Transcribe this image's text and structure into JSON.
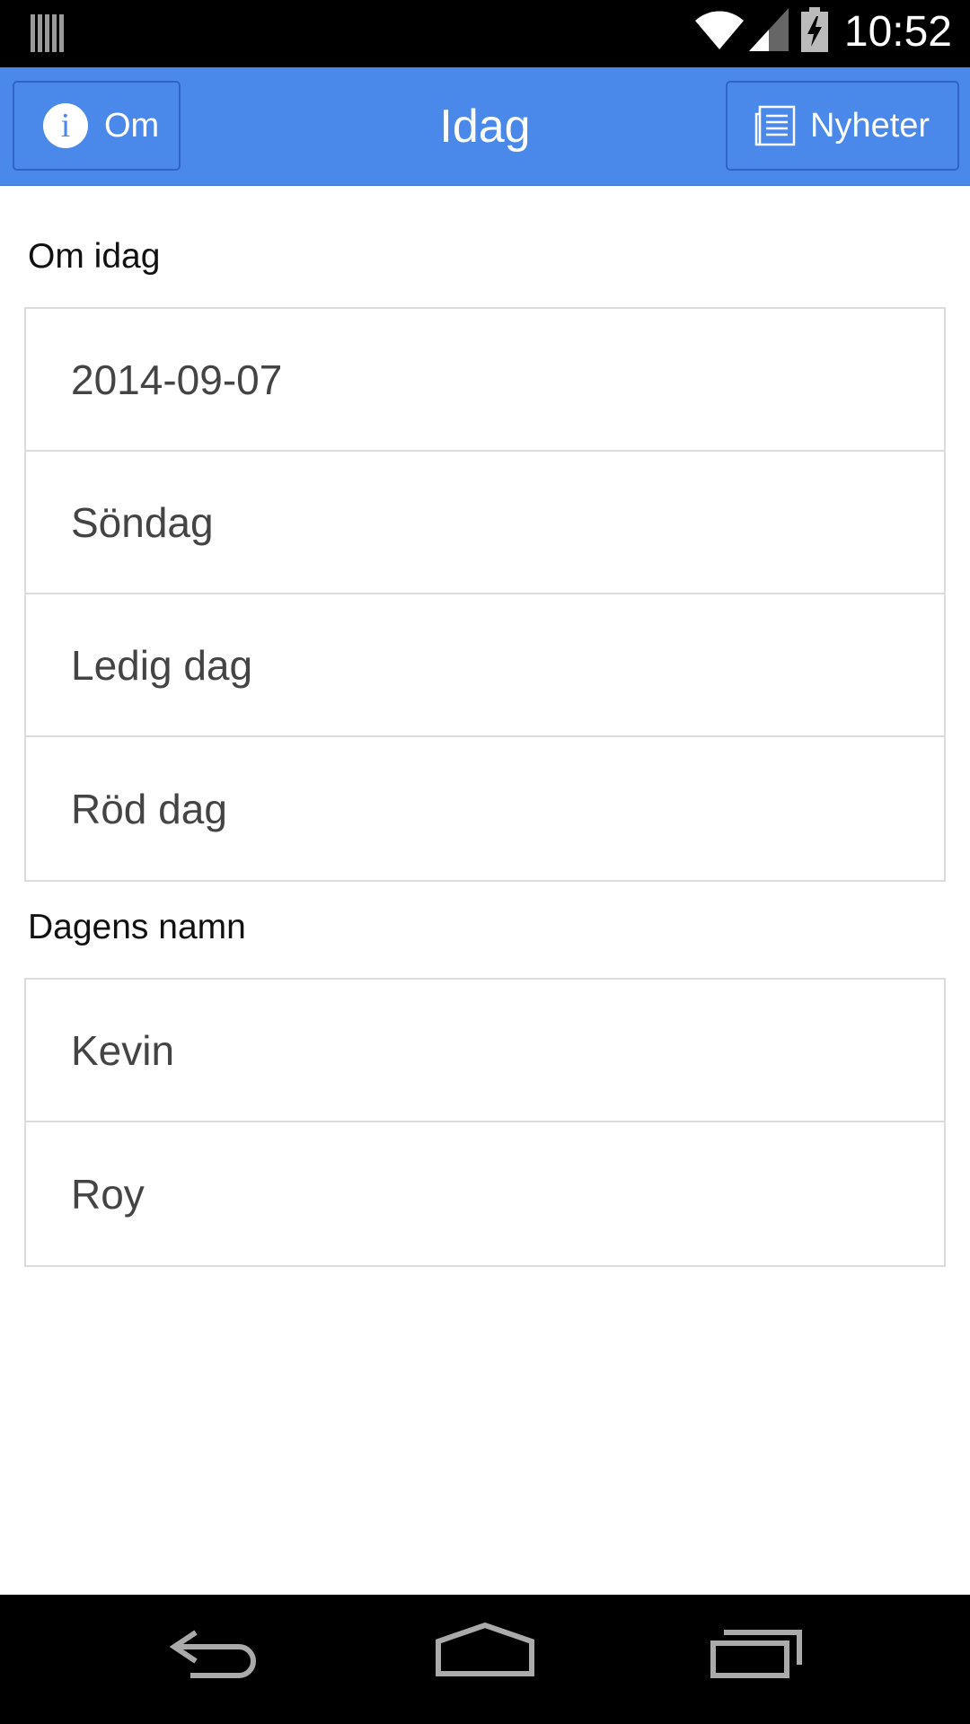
{
  "status_bar": {
    "time": "10:52"
  },
  "action_bar": {
    "title": "Idag",
    "left_button_label": "Om",
    "right_button_label": "Nyheter"
  },
  "sections": [
    {
      "label": "Om idag",
      "items": [
        "2014-09-07",
        "Söndag",
        "Ledig dag",
        "Röd dag"
      ]
    },
    {
      "label": "Dagens namn",
      "items": [
        "Kevin",
        "Roy"
      ]
    }
  ],
  "colors": {
    "accent": "#4a89ea",
    "border": "#dcdcdc",
    "text": "#444444"
  },
  "icons": {
    "status_left": "bars-icon",
    "wifi": "wifi-icon",
    "signal": "signal-icon",
    "battery": "battery-charging-icon",
    "info": "info-icon",
    "news": "news-icon",
    "back": "back-icon",
    "home": "home-icon",
    "recents": "recents-icon"
  }
}
